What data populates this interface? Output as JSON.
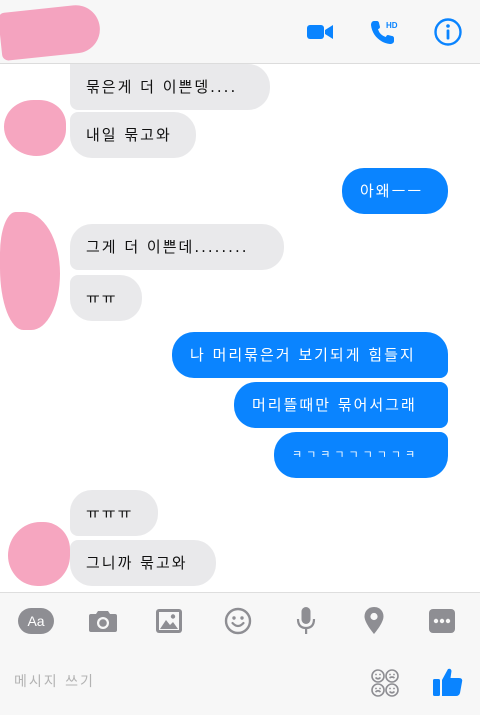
{
  "colors": {
    "accent": "#0a84ff",
    "incoming_bubble": "#e9e9eb",
    "outgoing_bubble": "#0a84ff",
    "redaction": "#f6a6c0"
  },
  "header": {
    "icons": [
      "video-call-icon",
      "hd-voice-call-icon",
      "info-icon"
    ],
    "hd_badge": "HD"
  },
  "messages": [
    {
      "side": "in",
      "text": "묶은게 더 이쁜뎅...."
    },
    {
      "side": "in",
      "text": "내일 묶고와"
    },
    {
      "side": "out",
      "text": "아왜ㅡㅡ"
    },
    {
      "side": "in",
      "text": "그게 더 이쁜데........"
    },
    {
      "side": "in",
      "text": "ㅠㅠ"
    },
    {
      "side": "out",
      "text": "나 머리묶은거 보기되게 힘들지"
    },
    {
      "side": "out",
      "text": "머리뜰때만 묶어서그래"
    },
    {
      "side": "out",
      "text": "ㅋㄱㅋㄱㄱㄱㄱㄱㅋ"
    },
    {
      "side": "in",
      "text": "ㅠㅠㅠ"
    },
    {
      "side": "in",
      "text": "그니까 묶고와"
    }
  ],
  "toolbar": {
    "aa_label": "Aa",
    "icons": [
      "text-size-icon",
      "camera-icon",
      "image-icon",
      "emoji-smiley-icon",
      "microphone-icon",
      "location-icon",
      "more-icon"
    ]
  },
  "composer": {
    "placeholder": "메시지 쓰기",
    "icons": [
      "emoji-faces-icon",
      "thumbs-up-icon"
    ]
  }
}
